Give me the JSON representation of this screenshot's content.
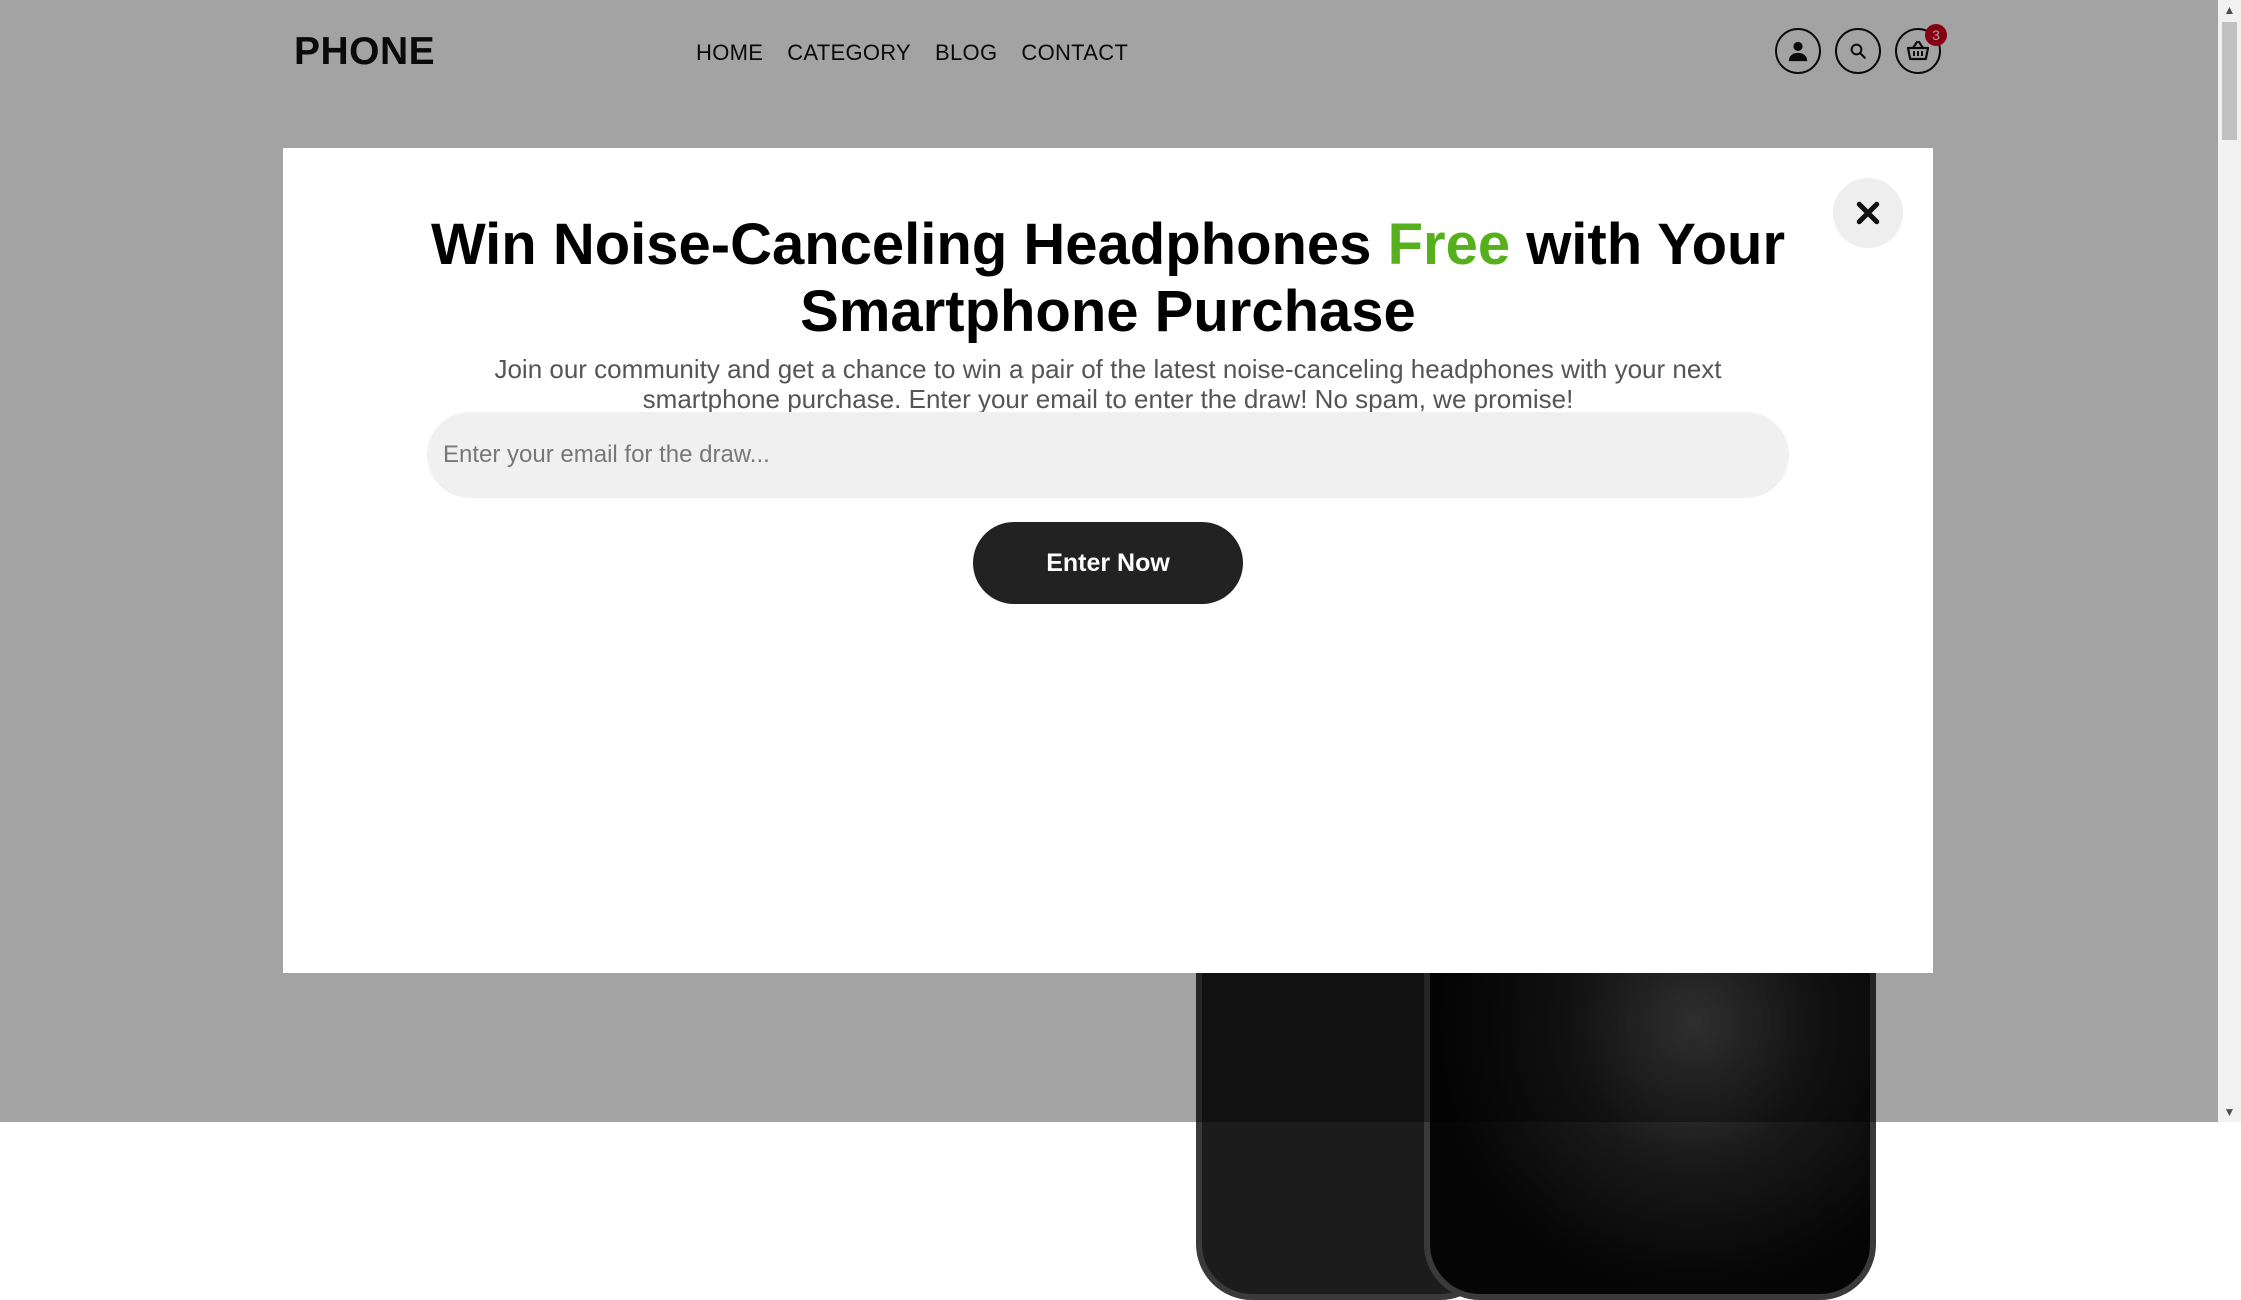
{
  "site": {
    "logo": "PHONE",
    "nav": [
      "HOME",
      "CATEGORY",
      "BLOG",
      "CONTACT"
    ],
    "cart_count": "3"
  },
  "popup": {
    "headline_part1": "Win Noise-Canceling Headphones ",
    "headline_accent": "Free",
    "headline_part2": " with Your Smartphone Purchase",
    "subtext": "Join our community and get a chance to win a pair of the latest noise-canceling headphones with your next smartphone purchase. Enter your email to enter the draw! No spam, we promise!",
    "email_placeholder": "Enter your email for the draw...",
    "email_value": "",
    "submit_label": "Enter Now",
    "close_icon": "close-icon"
  },
  "colors": {
    "accent": "#55b01c",
    "button": "#222222",
    "badge": "#d0021b",
    "overlay": "rgba(0,0,0,0.36)"
  },
  "icons": [
    "user-icon",
    "search-icon",
    "cart-icon"
  ]
}
